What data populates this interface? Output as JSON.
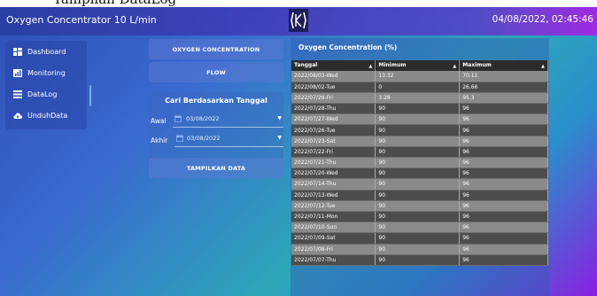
{
  "caption": "Tampilan DataLog",
  "app": {
    "title": "Oxygen Concentrator 10 L/min",
    "datetime": "04/08/2022, 02:45:46"
  },
  "sidebar": {
    "items": [
      {
        "label": "Dashboard",
        "icon": "dashboard-icon"
      },
      {
        "label": "Monitoring",
        "icon": "chart-icon"
      },
      {
        "label": "DataLog",
        "icon": "list-icon"
      },
      {
        "label": "UnduhData",
        "icon": "cloud-download-icon"
      }
    ]
  },
  "controls": {
    "btn_oxygen": "OXYGEN CONCENTRATION",
    "btn_flow": "FLOW",
    "search_title": "Cari Berdasarkan Tanggal",
    "awal_label": "Awal",
    "awal_value": "03/08/2022",
    "akhir_label": "Akhir",
    "akhir_value": "03/08/2022",
    "btn_show": "TAMPILKAN DATA"
  },
  "table": {
    "title": "Oxygen Concentration (%)",
    "headers": [
      "Tanggal",
      "Minimum",
      "Maximum"
    ],
    "rows": [
      [
        "2022/08/03-Wed",
        "13.32",
        "70.11"
      ],
      [
        "2022/08/02-Tue",
        "0",
        "26.66"
      ],
      [
        "2022/07/29-Fri",
        "3.28",
        "95.3"
      ],
      [
        "2022/07/28-Thu",
        "90",
        "96"
      ],
      [
        "2022/07/27-Wed",
        "90",
        "96"
      ],
      [
        "2022/07/26-Tue",
        "90",
        "96"
      ],
      [
        "2022/07/23-Sat",
        "90",
        "96"
      ],
      [
        "2022/07/22-Fri",
        "90",
        "96"
      ],
      [
        "2022/07/21-Thu",
        "90",
        "96"
      ],
      [
        "2022/07/20-Wed",
        "90",
        "96"
      ],
      [
        "2022/07/14-Thu",
        "90",
        "96"
      ],
      [
        "2022/07/13-Wed",
        "90",
        "96"
      ],
      [
        "2022/07/12-Tue",
        "90",
        "96"
      ],
      [
        "2022/07/11-Mon",
        "90",
        "96"
      ],
      [
        "2022/07/10-Sun",
        "90",
        "96"
      ],
      [
        "2022/07/09-Sat",
        "90",
        "96"
      ],
      [
        "2022/07/08-Fri",
        "90",
        "96"
      ],
      [
        "2022/07/07-Thu",
        "90",
        "96"
      ]
    ]
  }
}
